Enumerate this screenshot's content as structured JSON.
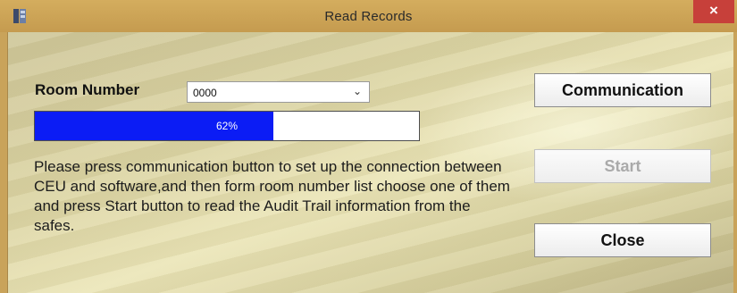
{
  "window": {
    "title": "Read Records",
    "close_glyph": "×",
    "colors": {
      "titlebar": "#c9a35a",
      "close_button": "#c7403a",
      "progress_fill": "#0b1cf5"
    }
  },
  "room": {
    "label": "Room Number",
    "selected_value": "0000"
  },
  "progress": {
    "percent": 62,
    "label": "62%"
  },
  "instructions": "Please press communication button to set up the connection  between CEU and software,and then form room number list choose one of them and press Start button to read the Audit Trail information from the safes.",
  "buttons": {
    "communication": "Communication",
    "start": "Start",
    "close": "Close"
  },
  "icons": [
    "app-icon",
    "chevron-down-icon",
    "close-icon"
  ]
}
